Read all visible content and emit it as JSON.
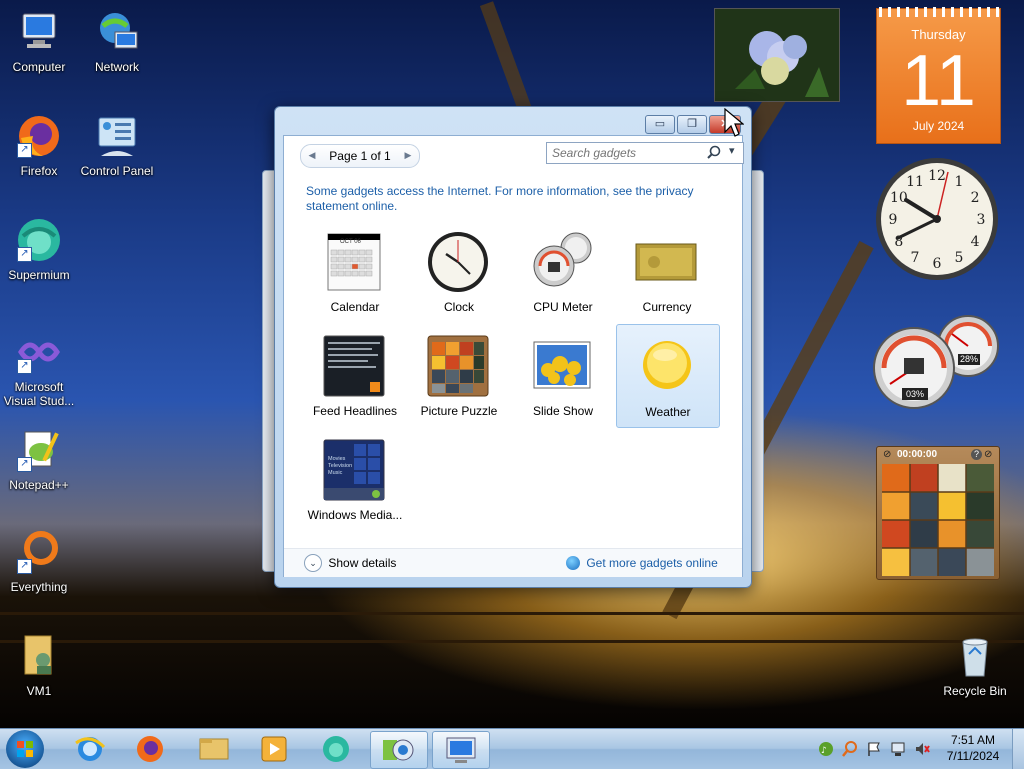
{
  "desktop": {
    "icons": [
      {
        "label": "Computer"
      },
      {
        "label": "Network"
      },
      {
        "label": "Firefox"
      },
      {
        "label": "Control Panel"
      },
      {
        "label": "Supermium"
      },
      {
        "label": "Microsoft Visual Stud..."
      },
      {
        "label": "Notepad++"
      },
      {
        "label": "Everything"
      },
      {
        "label": "VM1"
      },
      {
        "label": "Recycle Bin"
      }
    ]
  },
  "gadget_window": {
    "window_buttons": {
      "minimize": "▭",
      "restore": "❐",
      "close": "✕"
    },
    "pager": {
      "prev": "◀",
      "text": "Page 1 of 1",
      "next": "▶"
    },
    "search": {
      "placeholder": "Search gadgets",
      "icon": "search-icon",
      "dropdown": "▾"
    },
    "info_text": "Some gadgets access the Internet.  For more information, see the privacy statement online.",
    "gadgets": [
      {
        "label": "Calendar"
      },
      {
        "label": "Clock"
      },
      {
        "label": "CPU Meter"
      },
      {
        "label": "Currency"
      },
      {
        "label": "Feed Headlines"
      },
      {
        "label": "Picture Puzzle"
      },
      {
        "label": "Slide Show"
      },
      {
        "label": "Weather",
        "selected": true
      },
      {
        "label": "Windows Media..."
      }
    ],
    "calendar_thumb_month": "OCT 06",
    "media_thumb_lines": [
      "Movies",
      "Television",
      "Music"
    ],
    "footer": {
      "show_details": "Show details",
      "get_more": "Get more gadgets online"
    }
  },
  "side_gadgets": {
    "calendar": {
      "weekday": "Thursday",
      "day": "11",
      "month_year": "July 2024"
    },
    "clock": {
      "numbers": [
        "12",
        "1",
        "2",
        "3",
        "4",
        "5",
        "6",
        "7",
        "8",
        "9",
        "10",
        "11"
      ]
    },
    "cpu_meter": {
      "cpu": "03%",
      "memory": "28%"
    },
    "puzzle": {
      "timer": "00:00:00",
      "help": "?",
      "close": "⊘",
      "left": "⊘"
    }
  },
  "taskbar": {
    "start": "start-orb",
    "pinned": [
      "internet-explorer-icon",
      "firefox-icon",
      "explorer-icon",
      "media-player-icon",
      "supermium-icon",
      "gadgets-icon",
      "remote-desktop-icon"
    ],
    "clock": {
      "time": "7:51 AM",
      "date": "7/11/2024"
    }
  },
  "colors": {
    "accent_orange": "#e8701a",
    "link_blue": "#1c5fa8",
    "taskbar_blue": "#a9c6e3"
  }
}
